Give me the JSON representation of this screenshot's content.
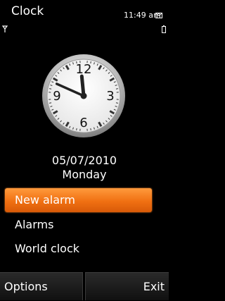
{
  "header": {
    "title": "Clock",
    "time": "11:49 am",
    "icons": [
      "signal-icon",
      "mail-icon",
      "battery-icon"
    ]
  },
  "clock": {
    "numerals": [
      "12",
      "3",
      "6",
      "9"
    ],
    "hour_hand_time": "11:49"
  },
  "date": {
    "date": "05/07/2010",
    "day": "Monday"
  },
  "menu": {
    "items": [
      {
        "label": "New alarm",
        "selected": true
      },
      {
        "label": "Alarms",
        "selected": false
      },
      {
        "label": "World clock",
        "selected": false
      }
    ]
  },
  "softkeys": {
    "left": "Options",
    "right": "Exit"
  },
  "colors": {
    "accent": "#f07012",
    "background": "#000000"
  }
}
